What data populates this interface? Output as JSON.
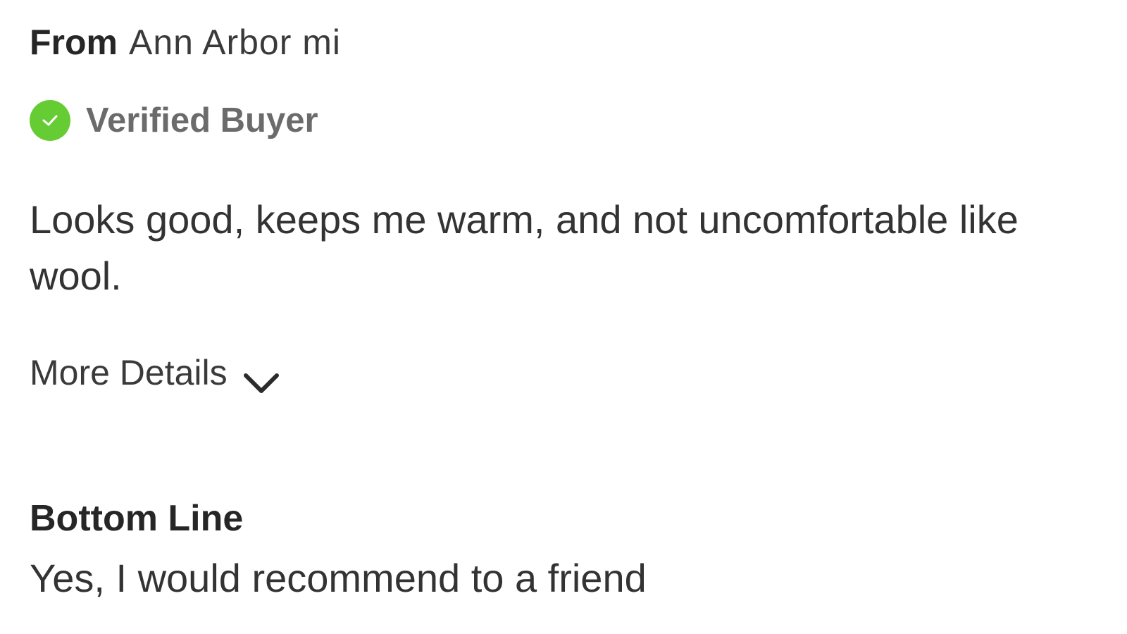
{
  "review": {
    "from_label": "From",
    "from_value": "Ann Arbor mi",
    "verified_label": "Verified Buyer",
    "verified_badge_color": "#66cc33",
    "body_text": "Looks good, keeps me warm, and not uncomfortable like wool.",
    "more_details_label": "More Details",
    "bottom_line_title": "Bottom Line",
    "bottom_line_value": "Yes, I would recommend to a friend"
  },
  "icons": {
    "verified": "check-circle-icon",
    "expand": "chevron-down-icon"
  }
}
